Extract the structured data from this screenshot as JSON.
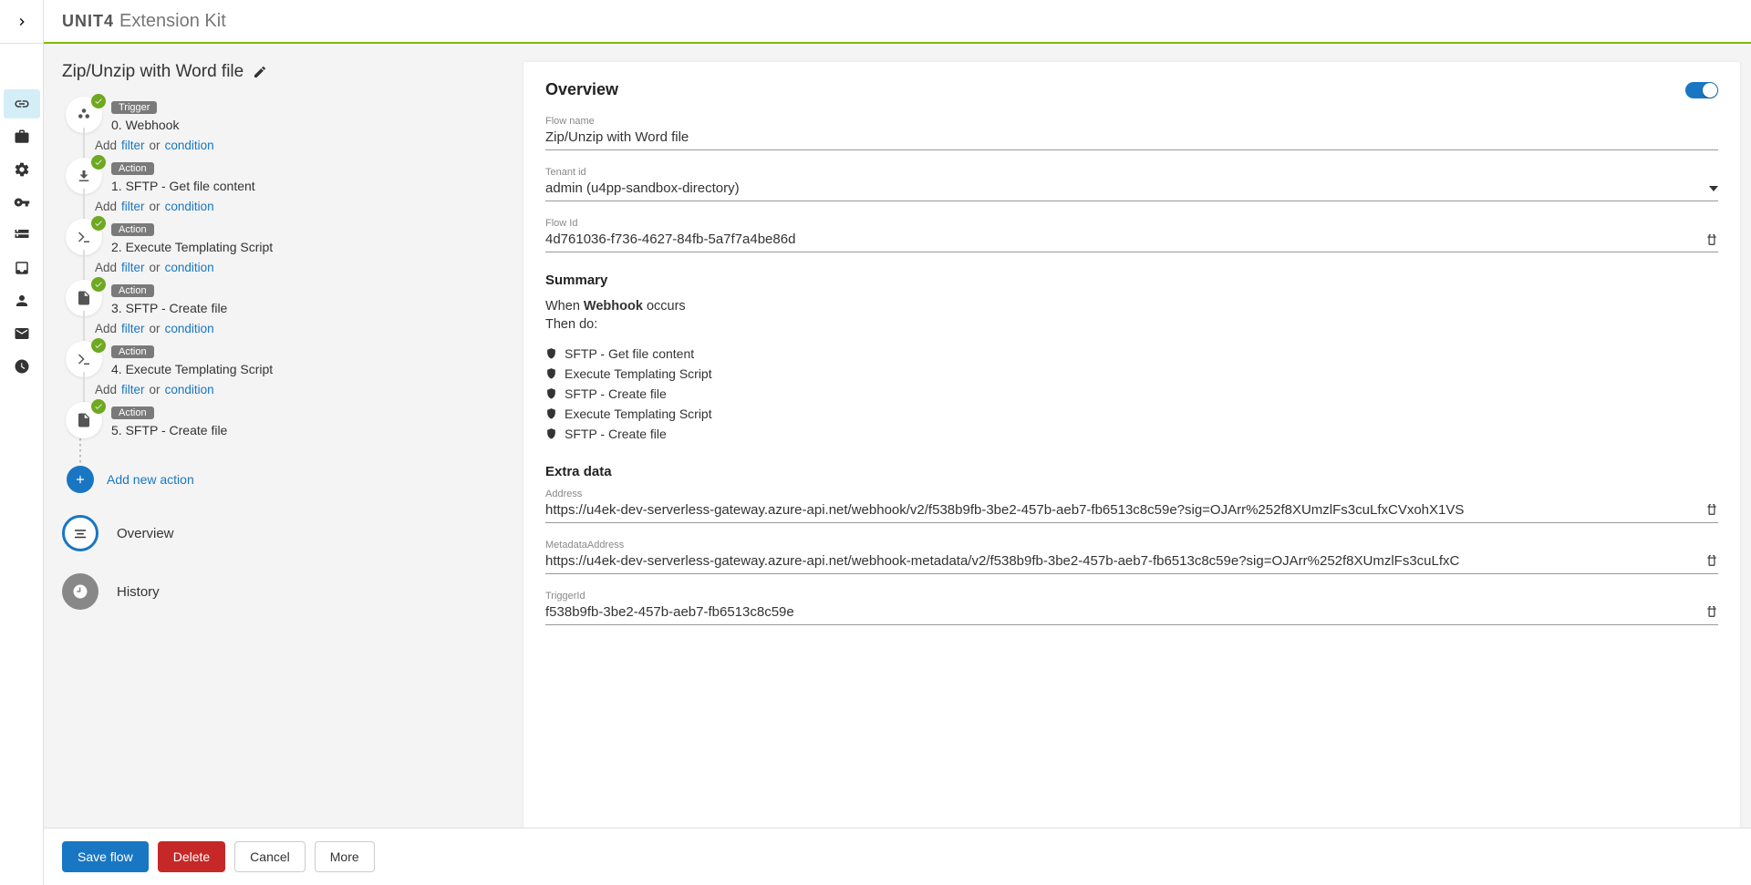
{
  "topbar": {
    "brand": "UNIT4",
    "product": "Extension Kit"
  },
  "flow": {
    "title": "Zip/Unzip with Word file",
    "steps": [
      {
        "tag": "Trigger",
        "label": "0. Webhook",
        "icon": "webhook"
      },
      {
        "tag": "Action",
        "label": "1. SFTP - Get file content",
        "icon": "download"
      },
      {
        "tag": "Action",
        "label": "2. Execute Templating Script",
        "icon": "terminal"
      },
      {
        "tag": "Action",
        "label": "3. SFTP - Create file",
        "icon": "file"
      },
      {
        "tag": "Action",
        "label": "4. Execute Templating Script",
        "icon": "terminal"
      },
      {
        "tag": "Action",
        "label": "5. SFTP - Create file",
        "icon": "file"
      }
    ],
    "filter_add": "Add",
    "filter_filter": "filter",
    "filter_or": "or",
    "filter_condition": "condition",
    "add_new_action": "Add new action",
    "nav_overview": "Overview",
    "nav_history": "History"
  },
  "overview": {
    "heading": "Overview",
    "toggle_on": true,
    "fields": {
      "flow_name_label": "Flow name",
      "flow_name_value": "Zip/Unzip with Word file",
      "tenant_label": "Tenant id",
      "tenant_value": "admin (u4pp-sandbox-directory)",
      "flow_id_label": "Flow Id",
      "flow_id_value": "4d761036-f736-4627-84fb-5a7f7a4be86d"
    },
    "summary_heading": "Summary",
    "summary_when": "When",
    "summary_webhook": "Webhook",
    "summary_occurs": "occurs",
    "summary_then": "Then do:",
    "summary_items": [
      "SFTP - Get file content",
      "Execute Templating Script",
      "SFTP - Create file",
      "Execute Templating Script",
      "SFTP - Create file"
    ],
    "extra_heading": "Extra data",
    "extra": {
      "address_label": "Address",
      "address_value": "https://u4ek-dev-serverless-gateway.azure-api.net/webhook/v2/f538b9fb-3be2-457b-aeb7-fb6513c8c59e?sig=OJArr%252f8XUmzlFs3cuLfxCVxohX1VS",
      "metadata_label": "MetadataAddress",
      "metadata_value": "https://u4ek-dev-serverless-gateway.azure-api.net/webhook-metadata/v2/f538b9fb-3be2-457b-aeb7-fb6513c8c59e?sig=OJArr%252f8XUmzlFs3cuLfxC",
      "trigger_label": "TriggerId",
      "trigger_value": "f538b9fb-3be2-457b-aeb7-fb6513c8c59e"
    }
  },
  "footer": {
    "save": "Save flow",
    "delete": "Delete",
    "cancel": "Cancel",
    "more": "More"
  }
}
